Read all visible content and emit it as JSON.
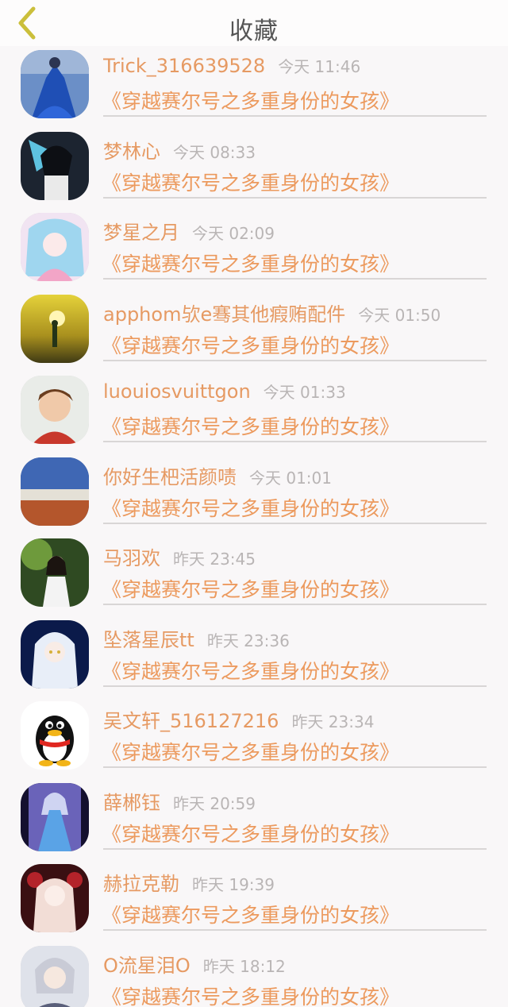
{
  "header": {
    "title": "收藏",
    "back_icon": "chevron-left-icon",
    "back_color": "#cbbf3b"
  },
  "colors": {
    "name": "#e69a63",
    "time": "#b9b5b5",
    "title": "#ec9a5e",
    "separator": "#d9d6d6"
  },
  "items": [
    {
      "name": "Trick_316639528",
      "time": "今天 11:46",
      "title": "《穿越赛尔号之多重身份的女孩》",
      "avatar": "blue-gown-avatar"
    },
    {
      "name": "梦林心",
      "time": "今天 08:33",
      "title": "《穿越赛尔号之多重身份的女孩》",
      "avatar": "anime-dark-avatar"
    },
    {
      "name": "梦星之月",
      "time": "今天 02:09",
      "title": "《穿越赛尔号之多重身份的女孩》",
      "avatar": "anime-pink-avatar"
    },
    {
      "name": "apphom欤e骞其他瘕贿配件",
      "time": "今天 01:50",
      "title": "《穿越赛尔号之多重身份的女孩》",
      "avatar": "sunset-avatar"
    },
    {
      "name": "luouiosvuittgon",
      "time": "今天 01:33",
      "title": "《穿越赛尔号之多重身份的女孩》",
      "avatar": "child-avatar"
    },
    {
      "name": "你好生杷活颜啧",
      "time": "今天 01:01",
      "title": "《穿越赛尔号之多重身份的女孩》",
      "avatar": "landscape-avatar"
    },
    {
      "name": "马羽欢",
      "time": "昨天 23:45",
      "title": "《穿越赛尔号之多重身份的女孩》",
      "avatar": "girl-forest-avatar"
    },
    {
      "name": "坠落星辰tt",
      "time": "昨天 23:36",
      "title": "《穿越赛尔号之多重身份的女孩》",
      "avatar": "anime-white-hair-avatar"
    },
    {
      "name": "吴文轩_516127216",
      "time": "昨天 23:34",
      "title": "《穿越赛尔号之多重身份的女孩》",
      "avatar": "penguin-avatar"
    },
    {
      "name": "薛郴钰",
      "time": "昨天 20:59",
      "title": "《穿越赛尔号之多重身份的女孩》",
      "avatar": "anime-blue-dress-avatar"
    },
    {
      "name": "赫拉克勒",
      "time": "昨天 19:39",
      "title": "《穿越赛尔号之多重身份的女孩》",
      "avatar": "anime-red-avatar"
    },
    {
      "name": "O流星泪O",
      "time": "昨天 18:12",
      "title": "《穿越赛尔号之多重身份的女孩》",
      "avatar": "anime-silver-avatar"
    }
  ]
}
